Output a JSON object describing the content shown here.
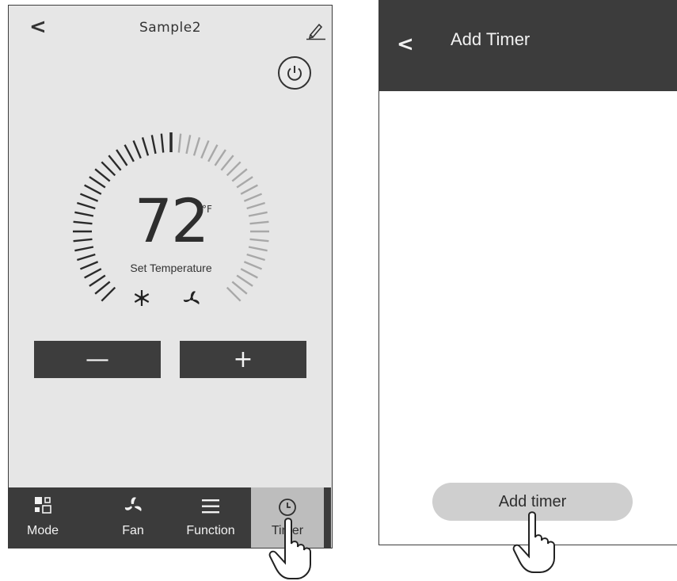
{
  "left_screen": {
    "back_glyph": "<",
    "title": "Sample2",
    "edit_icon": "pencil-icon",
    "power_icon": "power-icon",
    "temperature": {
      "value": "72",
      "unit": "°F",
      "label": "Set Temperature"
    },
    "status_icons": [
      "snowflake-icon",
      "fan-icon"
    ],
    "minus_label": "—",
    "plus_label": "+",
    "nav": [
      {
        "label": "Mode",
        "icon": "mode-icon"
      },
      {
        "label": "Fan",
        "icon": "fan-icon"
      },
      {
        "label": "Function",
        "icon": "menu-icon"
      },
      {
        "label": "Timer",
        "icon": "clock-icon",
        "active": true
      }
    ]
  },
  "right_screen": {
    "back_glyph": "<",
    "title": "Add Timer",
    "add_button_label": "Add timer"
  },
  "colors": {
    "header_dark": "#3c3c3c",
    "screen_bg": "#e6e6e6",
    "active_tab": "#bdbdbd",
    "button_light": "#cfcfcf"
  }
}
